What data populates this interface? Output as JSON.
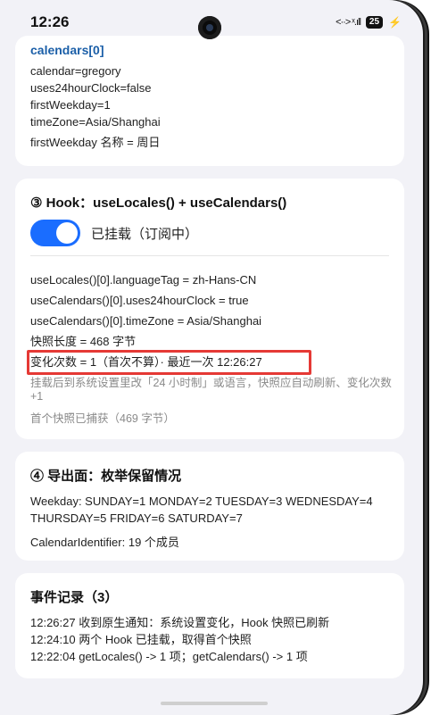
{
  "status_bar": {
    "time": "12:26",
    "signal_text": "<··> ˣ.ıll",
    "battery_level": "25",
    "charging_glyph": "⚡"
  },
  "calendars_card": {
    "title": "calendars[0]",
    "lines": [
      "calendar=gregory",
      "uses24hourClock=false",
      "firstWeekday=1",
      "timeZone=Asia/Shanghai"
    ],
    "first_weekday_name": "firstWeekday 名称 = 周日"
  },
  "hook_card": {
    "title": "③ Hook：useLocales() + useCalendars()",
    "toggle_on": true,
    "toggle_label": "已挂载（订阅中）",
    "lines": [
      "useLocales()[0].languageTag = zh-Hans-CN",
      "useCalendars()[0].uses24hourClock = true",
      "useCalendars()[0].timeZone = Asia/Shanghai",
      "快照长度 = 468 字节"
    ],
    "change_count": "变化次数 = 1（首次不算）· 最近一次 12:26:27",
    "note": "挂载后到系统设置里改「24 小时制」或语言，快照应自动刷新、变化次数 +1",
    "first_snapshot": "首个快照已捕获（469 字节）"
  },
  "export_card": {
    "title": "④ 导出面：枚举保留情况",
    "weekday": "Weekday: SUNDAY=1  MONDAY=2  TUESDAY=3  WEDNESDAY=4  THURSDAY=5  FRIDAY=6  SATURDAY=7",
    "calendar_identifier": "CalendarIdentifier: 19 个成员"
  },
  "events_card": {
    "title": "事件记录（3）",
    "events": [
      "12:26:27  收到原生通知：系统设置变化，Hook 快照已刷新",
      "12:24:10  两个 Hook 已挂载，取得首个快照",
      "12:22:04  getLocales() -> 1 项；getCalendars() -> 1 项"
    ]
  },
  "accent_color": "#1a6dff",
  "highlight_color": "#e53935",
  "title_color": "#1b5fa8"
}
